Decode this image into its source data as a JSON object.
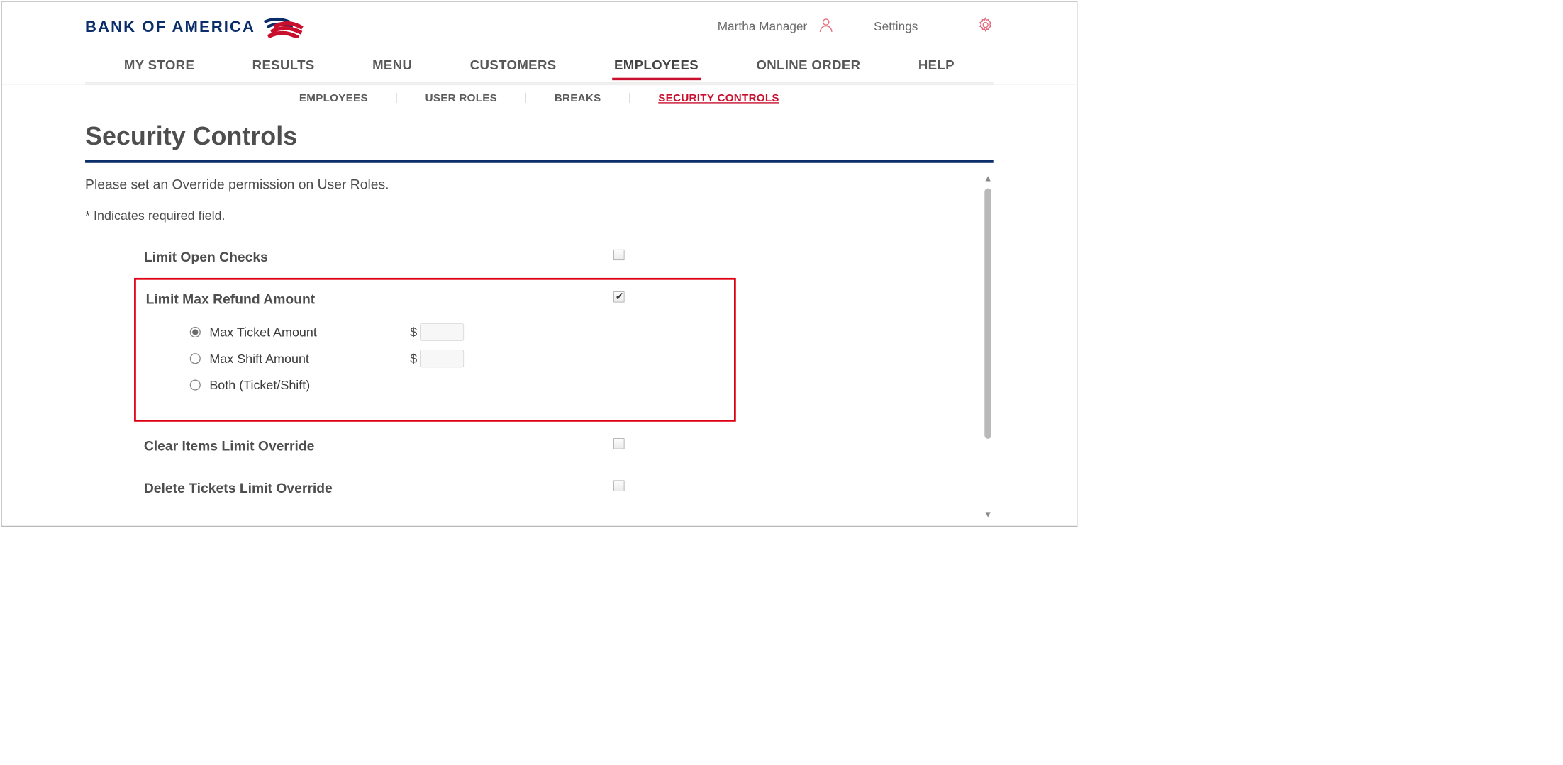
{
  "brand": {
    "name": "BANK OF AMERICA"
  },
  "header": {
    "user_name": "Martha Manager",
    "settings_label": "Settings"
  },
  "main_nav": {
    "items": [
      {
        "id": "my-store",
        "label": "MY STORE"
      },
      {
        "id": "results",
        "label": "RESULTS"
      },
      {
        "id": "menu",
        "label": "MENU"
      },
      {
        "id": "customers",
        "label": "CUSTOMERS"
      },
      {
        "id": "employees",
        "label": "EMPLOYEES",
        "active": true
      },
      {
        "id": "online-order",
        "label": "ONLINE ORDER"
      },
      {
        "id": "help",
        "label": "HELP"
      }
    ]
  },
  "sub_nav": {
    "items": [
      {
        "id": "employees",
        "label": "EMPLOYEES"
      },
      {
        "id": "user-roles",
        "label": "USER ROLES"
      },
      {
        "id": "breaks",
        "label": "BREAKS"
      },
      {
        "id": "security-controls",
        "label": "SECURITY CONTROLS",
        "active": true
      }
    ]
  },
  "page": {
    "title": "Security Controls",
    "hint_cut": "Please set an Override permission on User Roles.",
    "required_note": "* Indicates required field."
  },
  "settings": {
    "limit_open_checks": {
      "label": "Limit Open Checks",
      "checked": false
    },
    "limit_max_refund": {
      "label": "Limit Max Refund Amount",
      "checked": true,
      "options": {
        "max_ticket": {
          "label": "Max Ticket Amount",
          "currency": "$",
          "value": "",
          "selected": true
        },
        "max_shift": {
          "label": "Max Shift Amount",
          "currency": "$",
          "value": "",
          "selected": false
        },
        "both": {
          "label": "Both (Ticket/Shift)",
          "selected": false
        }
      }
    },
    "clear_items_override": {
      "label": "Clear Items Limit Override",
      "checked": false
    },
    "delete_tickets_override": {
      "label": "Delete Tickets Limit Override",
      "checked": false
    }
  }
}
